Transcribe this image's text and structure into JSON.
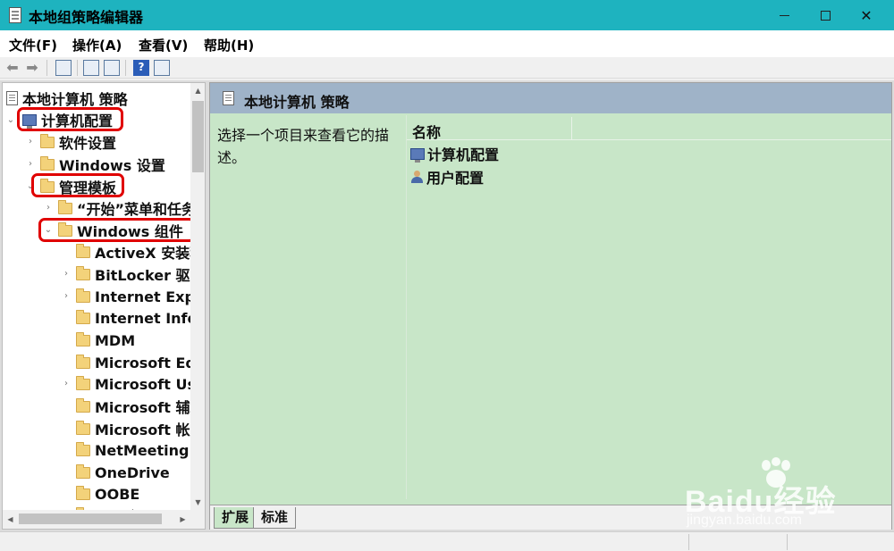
{
  "window": {
    "title": "本地组策略编辑器"
  },
  "menu": {
    "items": [
      "文件(F)",
      "操作(A)",
      "查看(V)",
      "帮助(H)"
    ]
  },
  "tree": {
    "items": [
      {
        "label": "本地计算机 策略"
      },
      {
        "label": "计算机配置"
      },
      {
        "label": "软件设置"
      },
      {
        "label": "Windows 设置"
      },
      {
        "label": "管理模板"
      },
      {
        "label": "“开始”菜单和任务"
      },
      {
        "label": "Windows 组件"
      },
      {
        "label": "ActiveX 安装程"
      },
      {
        "label": "BitLocker 驱动"
      },
      {
        "label": "Internet Expl"
      },
      {
        "label": "Internet Info"
      },
      {
        "label": "MDM"
      },
      {
        "label": "Microsoft Ed"
      },
      {
        "label": "Microsoft Us"
      },
      {
        "label": "Microsoft 辅助"
      },
      {
        "label": "Microsoft 帐户"
      },
      {
        "label": "NetMeeting"
      },
      {
        "label": "OneDrive"
      },
      {
        "label": "OOBE"
      },
      {
        "label": "RSS 源"
      }
    ]
  },
  "right": {
    "header_title": "本地计算机 策略",
    "description": "选择一个项目来查看它的描述。",
    "column_name": "名称",
    "rows": [
      {
        "label": "计算机配置",
        "icon": "computer-config-icon"
      },
      {
        "label": "用户配置",
        "icon": "user-config-icon"
      }
    ]
  },
  "tabs": {
    "expanded": "扩展",
    "standard": "标准"
  },
  "watermark": {
    "brand": "Baidu经验",
    "url": "jingyan.baidu.com"
  },
  "colors": {
    "titlebar": "#1eb3bf",
    "highlight_box": "#e00000",
    "content_background": "#c8e6c8",
    "header_background": "#9fb3c8"
  }
}
